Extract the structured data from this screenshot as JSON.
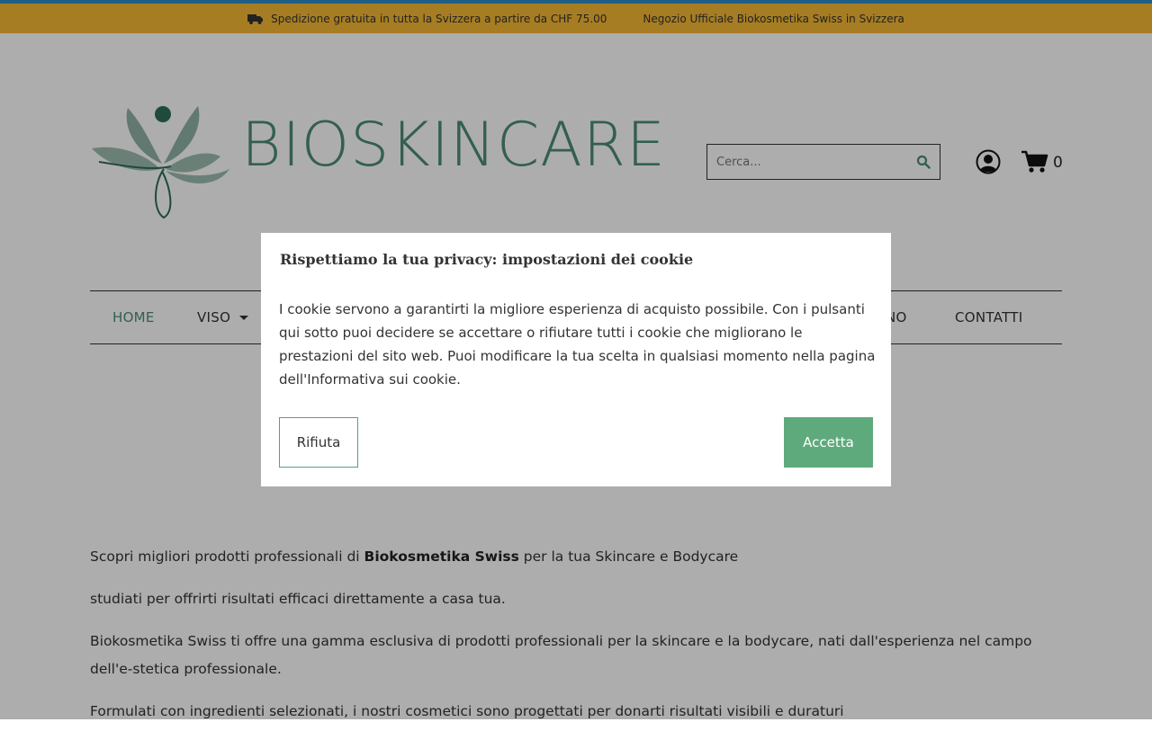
{
  "topbar": {
    "shipping_text": "Spedizione gratuita in tutta la Svizzera a partire da CHF 75.00",
    "store_text": "Negozio Ufficiale Biokosmetika Swiss in Svizzera",
    "background_color": "#f5b833",
    "truck_icon": "truck-icon"
  },
  "header": {
    "brand": "BIOSKINCARE",
    "brand_color": "#4c8c77",
    "search": {
      "placeholder": "Cerca..."
    },
    "cart_count": "0"
  },
  "nav": {
    "items": [
      {
        "label": "HOME",
        "active": true
      },
      {
        "label": "VISO",
        "has_dropdown": true
      },
      {
        "label": "NO",
        "partially_hidden": true
      },
      {
        "label": "CONTATTI"
      }
    ]
  },
  "content": {
    "p1_before": "Scopri migliori prodotti professionali di ",
    "p1_brand": "Biokosmetika Swiss",
    "p1_after": " per la tua Skincare e Bodycare",
    "p2": "studiati per offrirti risultati efficaci direttamente a casa tua.",
    "p3": "Biokosmetika Swiss ti offre una gamma esclusiva di prodotti professionali per la skincare e la bodycare, nati dall'esperienza nel campo dell'e-stetica professionale.",
    "p4": "Formulati con ingredienti selezionati, i nostri cosmetici sono progettati per donarti risultati visibili e duraturi"
  },
  "cookie_modal": {
    "title": "Rispettiamo la tua privacy: impostazioni dei cookie",
    "body": "I cookie servono a garantirti la migliore esperienza di acquisto possibile. Con i pulsanti qui sotto puoi decidere se accettare o rifiutare tutti i cookie che migliorano le prestazioni del sito web. Puoi modificare la tua scelta in qualsiasi momento nella pagina dell'Informativa sui cookie.",
    "reject_label": "Rifiuta",
    "accept_label": "Accetta",
    "accept_color": "#5faa7c"
  }
}
